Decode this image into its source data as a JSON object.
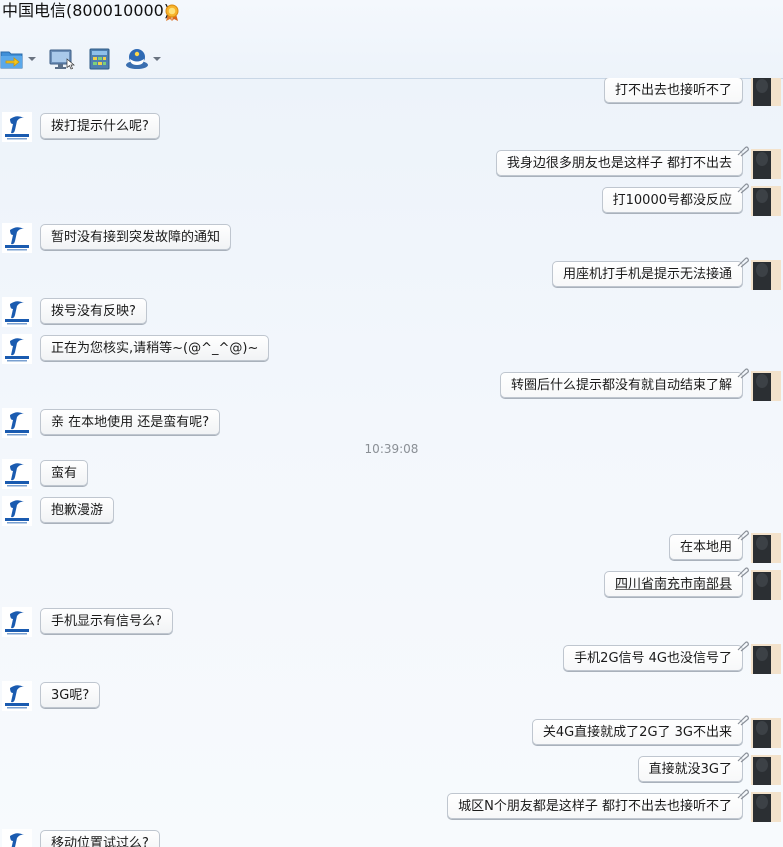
{
  "window": {
    "title": "中国电信(800010000)"
  },
  "toolbar": {
    "icons": [
      "folder-transfer-icon",
      "remote-desktop-icon",
      "apps-icon",
      "service-avatar-icon"
    ]
  },
  "messages": [
    {
      "side": "right",
      "text": "打不出去也接听不了"
    },
    {
      "side": "left",
      "text": "拨打提示什么呢?"
    },
    {
      "side": "right",
      "text": "我身边很多朋友也是这样子 都打不出去"
    },
    {
      "side": "right",
      "text": "打10000号都没反应"
    },
    {
      "side": "left",
      "text": "暂时没有接到突发故障的通知"
    },
    {
      "side": "right",
      "text": "用座机打手机是提示无法接通"
    },
    {
      "side": "left",
      "text": "拨号没有反映?"
    },
    {
      "side": "left",
      "text": "正在为您核实,请稍等~(@^_^@)~"
    },
    {
      "side": "right",
      "text": "转圈后什么提示都没有就自动结束了解"
    },
    {
      "side": "left",
      "text": "亲 在本地使用 还是蛮有呢?"
    },
    {
      "side": "time",
      "text": "10:39:08"
    },
    {
      "side": "left",
      "text": "蛮有"
    },
    {
      "side": "left",
      "text": "抱歉漫游"
    },
    {
      "side": "right",
      "text": "在本地用"
    },
    {
      "side": "right",
      "text": "四川省南充市南部县"
    },
    {
      "side": "left",
      "text": "手机显示有信号么?"
    },
    {
      "side": "right",
      "text": "手机2G信号 4G也没信号了"
    },
    {
      "side": "left",
      "text": "3G呢?"
    },
    {
      "side": "right",
      "text": "关4G直接就成了2G了  3G不出来"
    },
    {
      "side": "right",
      "text": "直接就没3G了"
    },
    {
      "side": "right",
      "text": "城区N个朋友都是这样子 都打不出去也接听不了"
    },
    {
      "side": "left",
      "text": "移动位置试过么?"
    }
  ]
}
